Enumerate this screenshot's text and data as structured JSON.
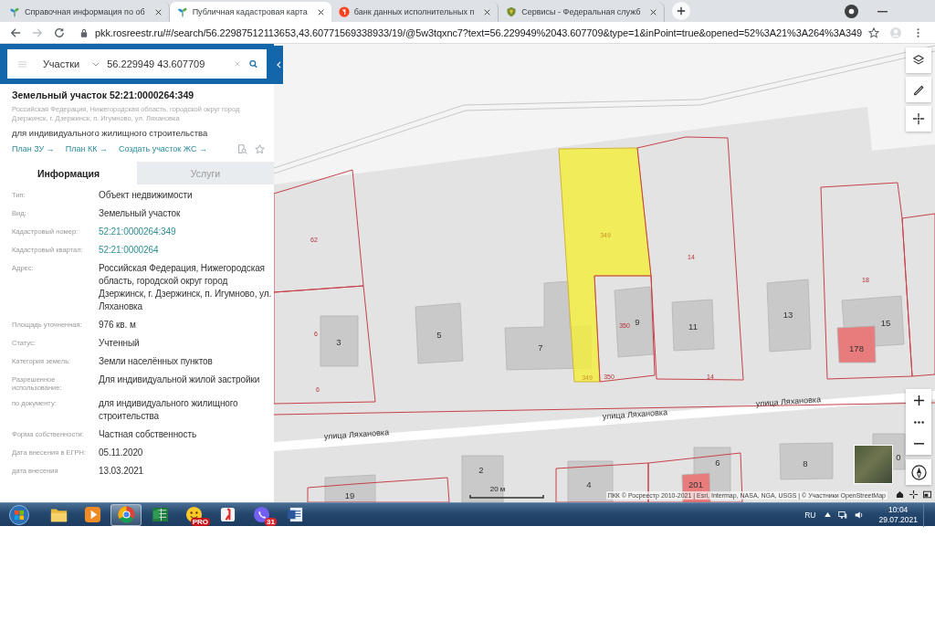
{
  "browser": {
    "tabs": [
      {
        "title": "Справочная информация по об",
        "kind": "sprout",
        "selected": false
      },
      {
        "title": "Публичная кадастровая карта",
        "kind": "sprout",
        "selected": true
      },
      {
        "title": "банк данных исполнительных п",
        "kind": "disc",
        "selected": false
      },
      {
        "title": "Сервисы - Федеральная служб",
        "kind": "crest",
        "selected": false
      }
    ],
    "url": "pkk.rosreestr.ru/#/search/56.22987512113653,43.60771569338933/19/@5w3tqxnc7?text=56.229949%2043.607709&type=1&inPoint=true&opened=52%3A21%3A264%3A349"
  },
  "search": {
    "category": "Участки",
    "query": "56.229949 43.607709"
  },
  "parcel": {
    "title": "Земельный участок 52:21:0000264:349",
    "address": "Российская Федерация, Нижегородская область, городской округ город Дзержинск, г. Дзержинск, п. Игумново, ул. Ляхановка",
    "purpose": "для индивидуального жилищного строительства",
    "links": [
      "План ЗУ →",
      "План КК →",
      "Создать участок ЖС →"
    ]
  },
  "panel_tabs": [
    {
      "label": "Информация",
      "selected": true
    },
    {
      "label": "Услуги",
      "selected": false
    }
  ],
  "fields": [
    {
      "label": "Тип:",
      "value": "Объект недвижимости",
      "kind": "text"
    },
    {
      "label": "Вид:",
      "value": "Земельный участок",
      "kind": "text"
    },
    {
      "label": "Кадастровый номер:",
      "value": "52:21:0000264:349",
      "kind": "link"
    },
    {
      "label": "Кадастровый квартал:",
      "value": "52:21:0000264",
      "kind": "link"
    },
    {
      "label": "Адрес:",
      "value": "Российская Федерация, Нижегородская область, городской округ город Дзержинск, г. Дзержинск, п. Игумново, ул. Ляхановка",
      "kind": "text"
    },
    {
      "label": "Площадь уточненная:",
      "value": "976 кв. м",
      "kind": "text"
    },
    {
      "label": "Статус:",
      "value": "Учтенный",
      "kind": "text"
    },
    {
      "label": "Категория земель:",
      "value": "Земли населённых пунктов",
      "kind": "text"
    },
    {
      "label": "Разрешенное использование:",
      "value": "Для индивидуальной жилой застройки",
      "kind": "text"
    },
    {
      "label": "по документу:",
      "value": "для индивидуального жилищного строительства",
      "kind": "text"
    },
    {
      "label": "Форма собственности:",
      "value": "Частная собственность",
      "kind": "text"
    },
    {
      "label": "Дата внесения в ЕГРН:",
      "value": "05.11.2020",
      "kind": "text"
    },
    {
      "label": "дата внесения",
      "value": "13.03.2021",
      "kind": "text"
    }
  ],
  "map": {
    "parcels": [
      {
        "labels": [
          "62"
        ],
        "selected": false
      },
      {
        "labels": [
          "6",
          "6"
        ],
        "selected": false
      },
      {
        "labels": [
          "349",
          "349"
        ],
        "selected": true
      },
      {
        "labels": [
          "350",
          "350"
        ],
        "selected": false
      },
      {
        "labels": [
          "14",
          "14"
        ],
        "selected": false
      },
      {
        "labels": [
          "18"
        ],
        "selected": false
      },
      {
        "selected": false
      },
      {
        "selected": false
      },
      {
        "selected": false
      },
      {
        "selected": false
      }
    ],
    "buildings": [
      {
        "label": "3",
        "color": "#c9c9c9"
      },
      {
        "label": "5",
        "color": "#c9c9c9"
      },
      {
        "label": "7",
        "color": "#c9c9c9"
      },
      {
        "label": "9",
        "color": "#c9c9c9"
      },
      {
        "label": "11",
        "color": "#c9c9c9"
      },
      {
        "label": "13",
        "color": "#c9c9c9"
      },
      {
        "label": "15",
        "color": "#c9c9c9"
      },
      {
        "label": "178",
        "color": "#e87c7c"
      },
      {
        "label": "19",
        "color": "#c9c9c9"
      },
      {
        "label": "2",
        "color": "#c9c9c9"
      },
      {
        "label": "4",
        "color": "#c9c9c9"
      },
      {
        "label": "6",
        "color": "#c9c9c9"
      },
      {
        "label": "201",
        "color": "#e87c7c"
      },
      {
        "label": "8",
        "color": "#c9c9c9"
      },
      {
        "label": "0",
        "color": "#c9c9c9"
      }
    ],
    "streets": [
      "улица Ляхановка",
      "улица Ляхановка",
      "улица Ляхановка"
    ],
    "scale": "20 м",
    "attribution": "ПКК © Росреестр 2010-2021 | Esri, Intermap, NASA, NGA, USGS | © Участники OpenStreetMap"
  },
  "taskbar": {
    "apps": [
      {
        "kind": "folder",
        "selected": false
      },
      {
        "kind": "player",
        "selected": false
      },
      {
        "kind": "ring",
        "selected": true
      },
      {
        "kind": "sheet",
        "selected": false
      },
      {
        "kind": "smiley",
        "badge": "PRO",
        "selected": false
      },
      {
        "kind": "logo",
        "selected": false
      },
      {
        "kind": "chat",
        "badge": "31",
        "selected": false
      },
      {
        "kind": "doc",
        "selected": false
      }
    ],
    "language": "RU",
    "time": "10:04",
    "date": "29.07.2021"
  }
}
